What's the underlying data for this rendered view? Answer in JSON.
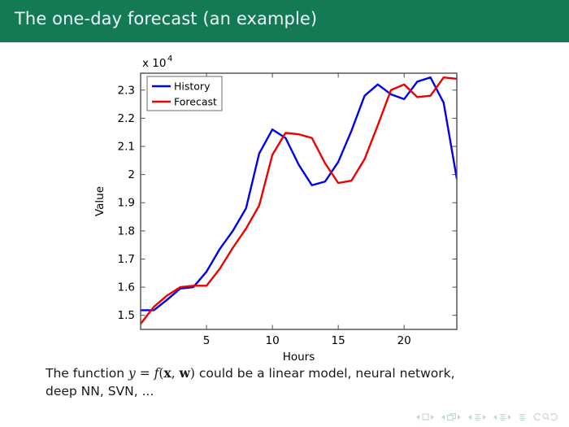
{
  "slide": {
    "title": "The one-day forecast (an example)",
    "header_color": "#137a55",
    "caption": {
      "line1_pre": "The function ",
      "math_y": "y",
      "math_eq": " = ",
      "math_f": "f",
      "math_open": "(",
      "math_x": "x",
      "math_comma": ", ",
      "math_w": "w",
      "math_close": ")",
      "line1_post": " could be a linear model, neural network,",
      "line2": "deep NN, SVN, ..."
    }
  },
  "navigation": {
    "items": [
      {
        "name": "nav-slide-prev",
        "label": "◂"
      },
      {
        "name": "nav-slide-icon",
        "label": "□"
      },
      {
        "name": "nav-slide-next",
        "label": "▸"
      },
      {
        "name": "nav-frame-prev",
        "label": "◂"
      },
      {
        "name": "nav-frame-icon",
        "label": "⧉"
      },
      {
        "name": "nav-frame-next",
        "label": "▸"
      },
      {
        "name": "nav-subsection-prev",
        "label": "◂"
      },
      {
        "name": "nav-subsection-icon",
        "label": "≡"
      },
      {
        "name": "nav-subsection-next",
        "label": "▸"
      },
      {
        "name": "nav-section-prev",
        "label": "◂"
      },
      {
        "name": "nav-section-icon",
        "label": "≡"
      },
      {
        "name": "nav-section-next",
        "label": "▸"
      },
      {
        "name": "nav-doc-icon",
        "label": "≡"
      },
      {
        "name": "nav-back-icon",
        "label": "↺"
      },
      {
        "name": "nav-search-icon",
        "label": "⌕"
      },
      {
        "name": "nav-forward-icon",
        "label": "↻"
      }
    ]
  },
  "chart_data": {
    "type": "line",
    "title": "",
    "xlabel": "Hours",
    "ylabel": "Value",
    "y_multiplier_label": "x 10",
    "y_multiplier_exp": "4",
    "y_scale": 10000,
    "xlim": [
      0,
      24
    ],
    "ylim": [
      1.45,
      2.36
    ],
    "xticks": [
      5,
      10,
      15,
      20
    ],
    "xtick_labels": [
      "5",
      "10",
      "15",
      "20"
    ],
    "yticks": [
      1.5,
      1.6,
      1.7,
      1.8,
      1.9,
      2.0,
      2.1,
      2.2,
      2.3
    ],
    "ytick_labels": [
      "1.5",
      "1.6",
      "1.7",
      "1.8",
      "1.9",
      "2",
      "2.1",
      "2.2",
      "2.3"
    ],
    "grid": false,
    "legend_position": "top-left",
    "x": [
      0,
      1,
      2,
      3,
      4,
      5,
      6,
      7,
      8,
      9,
      10,
      11,
      12,
      13,
      14,
      15,
      16,
      17,
      18,
      19,
      20,
      21,
      22,
      23,
      24
    ],
    "series": [
      {
        "name": "History",
        "color": "#0000ee",
        "values": [
          1.518,
          1.518,
          1.555,
          1.595,
          1.6,
          1.655,
          1.735,
          1.8,
          1.88,
          2.075,
          2.16,
          2.13,
          2.035,
          1.962,
          1.975,
          2.045,
          2.155,
          2.28,
          2.32,
          2.285,
          2.268,
          2.33,
          2.345,
          2.255,
          1.985
        ]
      },
      {
        "name": "Forecast",
        "color": "#ee0000",
        "values": [
          1.47,
          1.53,
          1.57,
          1.6,
          1.605,
          1.605,
          1.665,
          1.74,
          1.808,
          1.89,
          2.07,
          2.148,
          2.143,
          2.13,
          2.04,
          1.97,
          1.978,
          2.055,
          2.175,
          2.3,
          2.32,
          2.275,
          2.28,
          2.345,
          2.34
        ]
      }
    ]
  }
}
